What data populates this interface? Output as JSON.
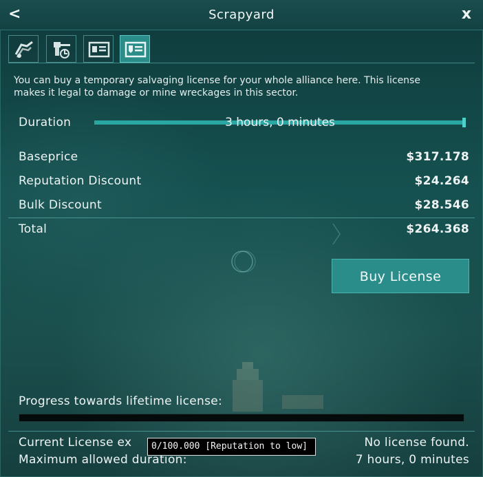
{
  "window": {
    "title": "Scrapyard",
    "back_glyph": "<",
    "close_glyph": "x"
  },
  "tabs": [
    {
      "icon": "salvage-icon",
      "active": false
    },
    {
      "icon": "turret-factory-icon",
      "active": false
    },
    {
      "icon": "license-card-icon",
      "active": false
    },
    {
      "icon": "license-document-icon",
      "active": true
    }
  ],
  "info_text": "You can buy a temporary salvaging license for your whole alliance here. This license makes it legal to damage or mine wreckages in this sector.",
  "duration": {
    "label": "Duration",
    "value": "3 hours, 0 minutes"
  },
  "prices": {
    "baseprice_label": "Baseprice",
    "baseprice_value": "$317.178",
    "reputation_label": "Reputation Discount",
    "reputation_value": "$24.264",
    "bulk_label": "Bulk Discount",
    "bulk_value": "$28.546",
    "total_label": "Total",
    "total_value": "$264.368"
  },
  "buy_button": "Buy License",
  "progress": {
    "label": "Progress towards lifetime license:",
    "value": 0,
    "max": 100000,
    "tooltip": "0/100.000 [Reputation to low]"
  },
  "license": {
    "current_label": "Current License ex",
    "current_value": "No license found.",
    "max_label": "Maximum allowed duration:",
    "max_value": "7 hours, 0 minutes"
  },
  "colors": {
    "accent": "#2a8d8a",
    "slider": "#2aa7a3",
    "panel_bg": "#155150"
  }
}
